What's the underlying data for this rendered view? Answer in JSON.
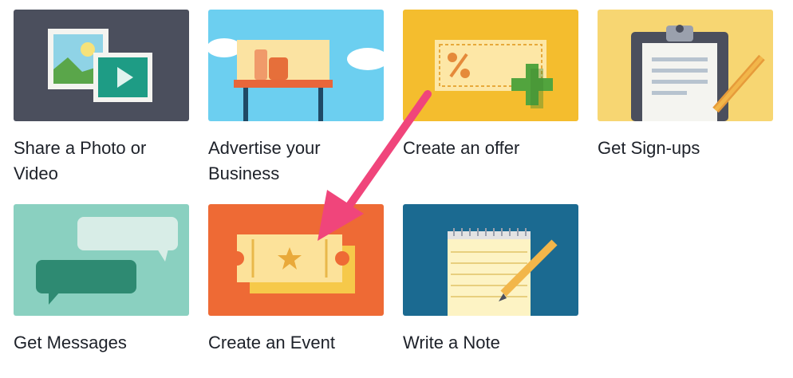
{
  "tiles": [
    {
      "id": "share-photo-video",
      "label": "Share a Photo or Video",
      "color": "#4b4f5d",
      "icon": "photo-video-icon"
    },
    {
      "id": "advertise-business",
      "label": "Advertise your Business",
      "color": "#6ccff0",
      "icon": "billboard-icon"
    },
    {
      "id": "create-offer",
      "label": "Create an offer",
      "color": "#f4bd2e",
      "icon": "coupon-icon"
    },
    {
      "id": "get-signups",
      "label": "Get Sign-ups",
      "color": "#f7d672",
      "icon": "clipboard-icon"
    },
    {
      "id": "get-messages",
      "label": "Get Messages",
      "color": "#8ad0c0",
      "icon": "chat-bubbles-icon"
    },
    {
      "id": "create-event",
      "label": "Create an Event",
      "color": "#ee6a35",
      "icon": "ticket-icon"
    },
    {
      "id": "write-note",
      "label": "Write a Note",
      "color": "#1b6a91",
      "icon": "notepad-icon"
    }
  ],
  "annotation": {
    "color": "#f0457b",
    "target": "create-event"
  }
}
